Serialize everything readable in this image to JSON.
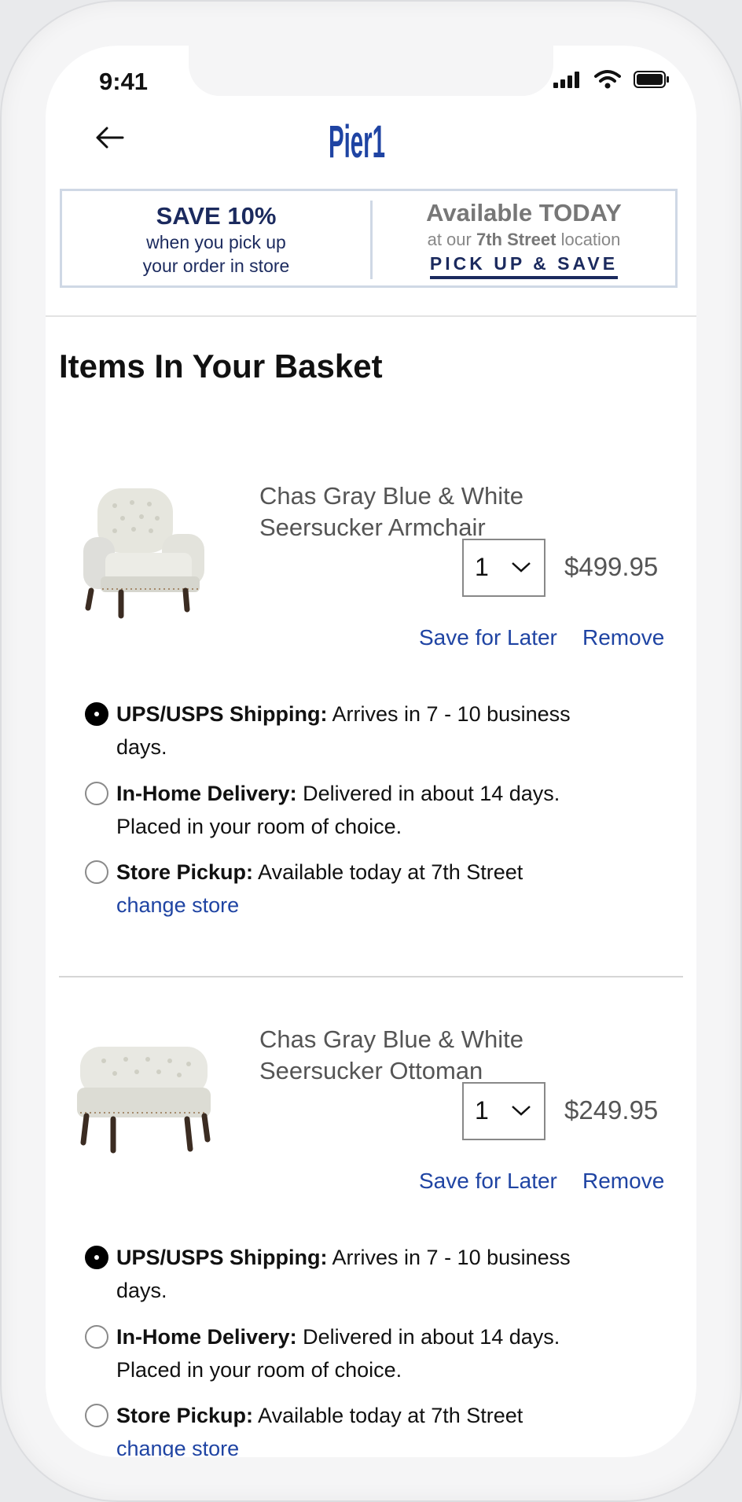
{
  "status_bar": {
    "time": "9:41"
  },
  "header": {
    "logo": "Pier1"
  },
  "promo": {
    "save_title": "SAVE 10%",
    "save_line1": "when you pick up",
    "save_line2": "your order in store",
    "available_title": "Available TODAY",
    "available_prefix": "at our ",
    "available_store": "7th Street",
    "available_suffix": " location",
    "pickup_link": "PICK UP & SAVE"
  },
  "basket": {
    "title": "Items In Your Basket",
    "items": [
      {
        "name_line1": "Chas Gray Blue & White",
        "name_line2": "Seersucker Armchair",
        "quantity": "1",
        "price": "$499.95",
        "save_for_later": "Save for Later",
        "remove": "Remove",
        "shipping_options": [
          {
            "label": "UPS/USPS Shipping:",
            "text_line1": " Arrives in 7 - 10 business",
            "text_line2": "days.",
            "selected": true
          },
          {
            "label": "In-Home Delivery:",
            "text_line1": " Delivered in about 14 days.",
            "text_line2": "Placed in your room of choice.",
            "selected": false
          },
          {
            "label": "Store Pickup:",
            "text_line1": " Available today at 7th Street",
            "text_line2": "change store",
            "selected": false
          }
        ]
      },
      {
        "name_line1": "Chas Gray Blue & White",
        "name_line2": "Seersucker Ottoman",
        "quantity": "1",
        "price": "$249.95",
        "save_for_later": "Save for Later",
        "remove": "Remove",
        "shipping_options": [
          {
            "label": "UPS/USPS Shipping:",
            "text_line1": " Arrives in 7 - 10 business",
            "text_line2": "days.",
            "selected": true
          },
          {
            "label": "In-Home Delivery:",
            "text_line1": " Delivered in about 14 days.",
            "text_line2": "Placed in your room of choice.",
            "selected": false
          },
          {
            "label": "Store Pickup:",
            "text_line1": " Available today at 7th Street",
            "text_line2": "change store",
            "selected": false
          }
        ]
      }
    ]
  },
  "colors": {
    "brand_navy": "#1b2a5e",
    "link_blue": "#1f44a3",
    "promo_border": "#cfd8e5"
  }
}
